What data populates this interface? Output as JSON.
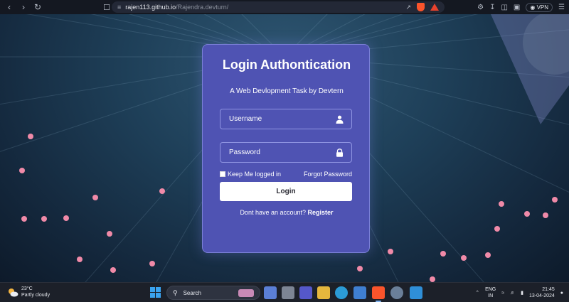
{
  "browser": {
    "url_host": "rajen113.github.io",
    "url_path": "/Rajendra.devturn/",
    "vpn_label": "VPN"
  },
  "login": {
    "title": "Login Authontication",
    "subtitle": "A Web Devlopment Task by Devtern",
    "username_placeholder": "Username",
    "password_placeholder": "Password",
    "remember_label": "Keep Me logged in",
    "forgot_label": "Forgot Password",
    "login_button": "Login",
    "no_account_text": "Dont have an account?",
    "register_label": "Register"
  },
  "taskbar": {
    "weather_temp": "23°C",
    "weather_desc": "Partly cloudy",
    "search_placeholder": "Search",
    "lang_line1": "ENG",
    "lang_line2": "IN",
    "time": "21:45",
    "date": "13-04-2024"
  },
  "colors": {
    "card_bg": "#4f53b3",
    "dot": "#f08aa8",
    "page_bg": "#1e3f58"
  }
}
